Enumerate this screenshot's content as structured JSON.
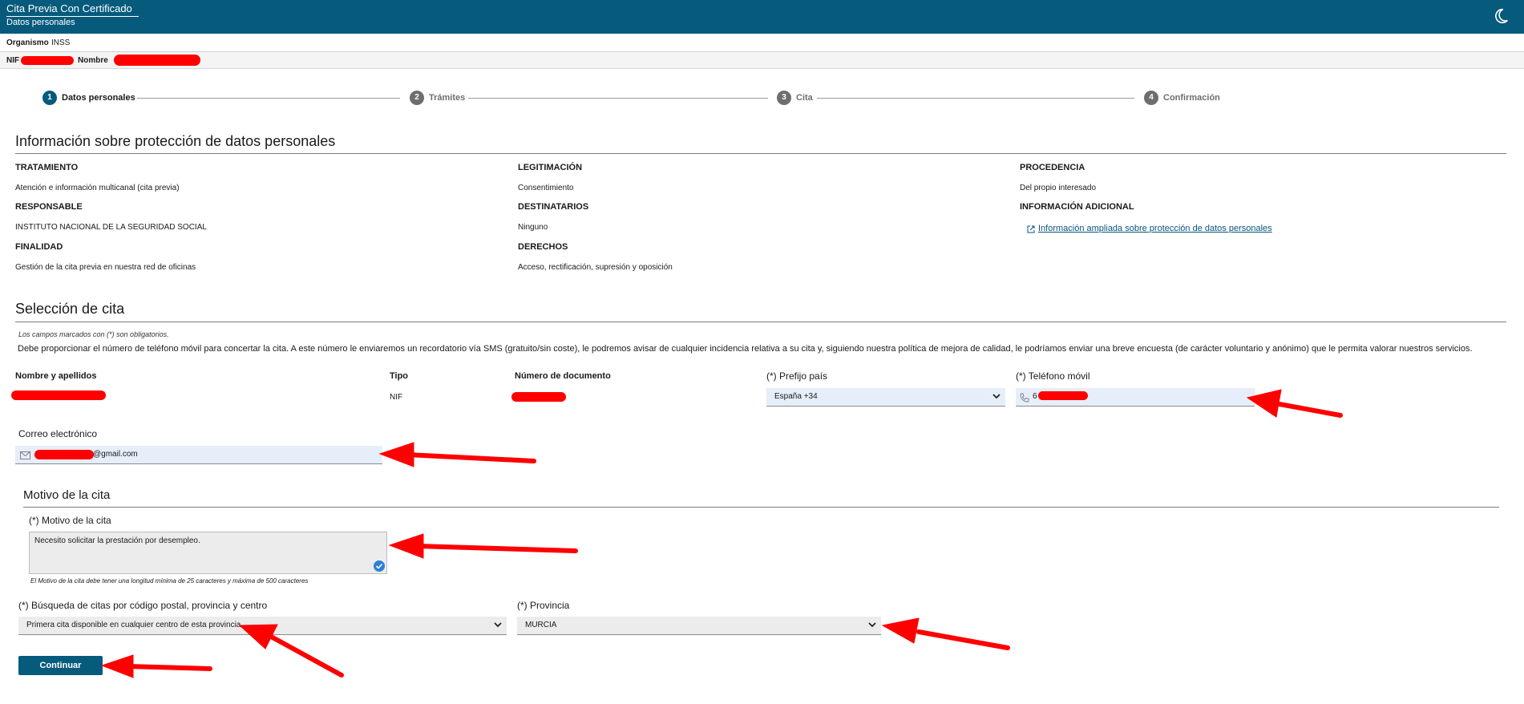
{
  "header": {
    "app_title": "Cita Previa Con Certificado",
    "subtitle": "Datos personales",
    "theme_icon": "moon-icon"
  },
  "org": {
    "label": "Organismo",
    "value": "INSS"
  },
  "user": {
    "nif_label": "NIF",
    "nombre_label": "Nombre"
  },
  "steps": [
    {
      "number": "1",
      "label": "Datos personales",
      "active": true
    },
    {
      "number": "2",
      "label": "Trámites",
      "active": false
    },
    {
      "number": "3",
      "label": "Cita",
      "active": false
    },
    {
      "number": "4",
      "label": "Confirmación",
      "active": false
    }
  ],
  "proteccion": {
    "title": "Información sobre protección de datos personales",
    "tratamiento": {
      "label": "TRATAMIENTO",
      "value": "Atención e información multicanal (cita previa)"
    },
    "legitimacion": {
      "label": "LEGITIMACIÓN",
      "value": "Consentimiento"
    },
    "procedencia": {
      "label": "PROCEDENCIA",
      "value": "Del propio interesado"
    },
    "responsable": {
      "label": "RESPONSABLE",
      "value": "INSTITUTO NACIONAL DE LA SEGURIDAD SOCIAL"
    },
    "destinatarios": {
      "label": "DESTINATARIOS",
      "value": "Ninguno"
    },
    "info_adicional": {
      "label": "INFORMACIÓN ADICIONAL",
      "link": "Información ampliada sobre protección de datos personales"
    },
    "finalidad": {
      "label": "FINALIDAD",
      "value": "Gestión de la cita previa en nuestra red de oficinas"
    },
    "derechos": {
      "label": "DERECHOS",
      "value": "Acceso, rectificación, supresión y oposición"
    }
  },
  "seleccion": {
    "title": "Selección de cita",
    "required_note": "Los campos marcados con (*) son obligatorios.",
    "sms_note": "Debe proporcionar el número de teléfono móvil para concertar la cita. A este número le enviaremos un recordatorio vía SMS (gratuito/sin coste), le podremos avisar de cualquier incidencia relativa a su cita y, siguiendo nuestra política de mejora de calidad, le podríamos enviar una breve encuesta (de carácter voluntario y anónimo) que le permita valorar nuestros servicios.",
    "nombre_label": "Nombre y apellidos",
    "tipo_label": "Tipo",
    "tipo_value": "NIF",
    "documento_label": "Número de documento",
    "prefijo_label": "(*) Prefijo país",
    "prefijo_value": "España +34",
    "telefono_label": "(*) Teléfono móvil",
    "telefono_value": "6",
    "email_label": "Correo electrónico",
    "email_value": "@gmail.com"
  },
  "motivo": {
    "section_title": "Motivo de la cita",
    "label": "(*) Motivo de la cita",
    "value": "Necesito solicitar la prestación por desempleo.",
    "hint": "El Motivo de la cita debe tener una longitud mínima de 25 caracteres y máxima de 500 caracteres",
    "busqueda_label": "(*) Búsqueda de citas por código postal, provincia y centro",
    "busqueda_value": "Primera cita disponible en cualquier centro de esta provincia",
    "provincia_label": "(*) Provincia",
    "provincia_value": "MURCIA"
  },
  "continue_label": "Continuar",
  "colors": {
    "brand": "#065b7c",
    "annotation": "#ff0000"
  }
}
